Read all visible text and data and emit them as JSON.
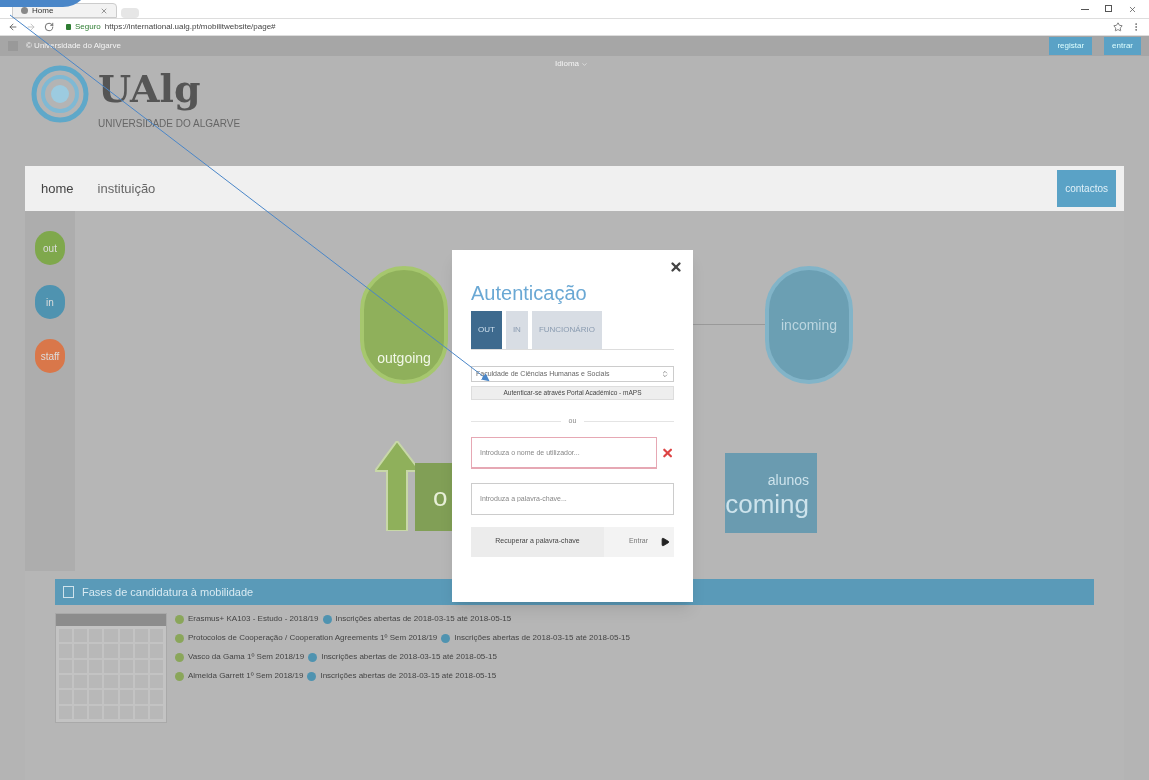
{
  "browser": {
    "tab_title": "Home",
    "secure_label": "Seguro",
    "url": "https://international.ualg.pt/mobilitwebsite/page#"
  },
  "top_bar": {
    "notice": "© Universidade do Algarve",
    "links": [
      "registar",
      "entrar"
    ],
    "language": "Idioma"
  },
  "logo": {
    "name": "UAlg",
    "subtitle": "UNIVERSIDADE DO ALGARVE"
  },
  "nav": {
    "items": [
      {
        "label": "home",
        "selected": true
      },
      {
        "label": "instituição",
        "selected": false
      }
    ],
    "contact": "contactos"
  },
  "side_buttons": [
    {
      "label": "out",
      "color": "#7fa84c"
    },
    {
      "label": "in",
      "color": "#4f93b0"
    },
    {
      "label": "staff",
      "color": "#d9774a"
    }
  ],
  "hero": {
    "left_circle": "outgoing",
    "right_circle": "incoming",
    "right_card_top": "alunos",
    "right_card_bottom": "coming",
    "left_card": "o"
  },
  "modal": {
    "title": "Autenticação",
    "tabs": [
      {
        "label": "OUT",
        "selected": true
      },
      {
        "label": "IN",
        "selected": false
      },
      {
        "label": "FUNCIONÁRIO",
        "selected": false
      }
    ],
    "select_value": "Faculdade de Ciências Humanas e Sociais",
    "portal_button": "Autenticar-se através Portal Académico - mAPS",
    "divider": "ou",
    "username_placeholder": "Introduza o nome de utilizador...",
    "username_error": true,
    "password_placeholder": "Introduza a palavra-chave...",
    "recover_button": "Recuperar a palavra-chave",
    "submit_button": "Entrar"
  },
  "phases": {
    "title": "Fases de candidatura à mobilidade",
    "items": [
      {
        "name": "Erasmus+ KA103 - Estudo - 2018/19",
        "status": "Inscrições abertas de 2018-03-15 até 2018-05-15"
      },
      {
        "name": "Protocolos de Cooperação / Cooperation Agreements 1º Sem 2018/19",
        "status": "Inscrições abertas de 2018-03-15 até 2018-05-15"
      },
      {
        "name": "Vasco da Gama 1º Sem 2018/19",
        "status": "Inscrições abertas de 2018-03-15 até 2018-05-15"
      },
      {
        "name": "Almeida Garrett 1º Sem 2018/19",
        "status": "Inscrições abertas de 2018-03-15 até 2018-05-15"
      }
    ]
  }
}
